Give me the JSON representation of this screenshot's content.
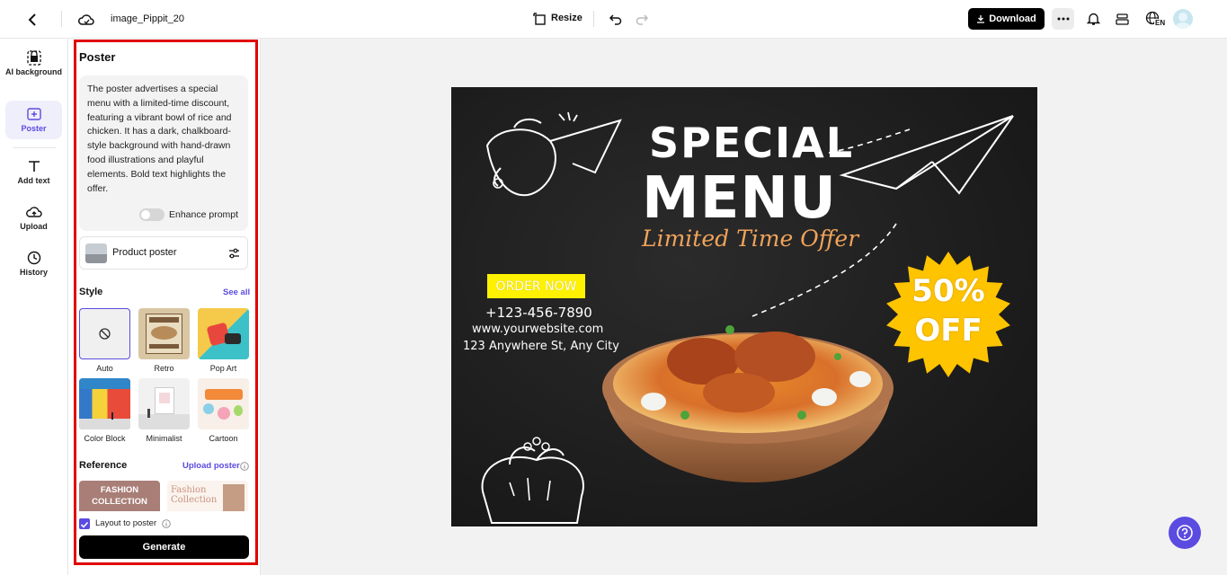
{
  "topbar": {
    "filename": "image_Pippit_20",
    "resize_label": "Resize",
    "download_label": "Download",
    "lang_badge": "EN"
  },
  "leftnav": {
    "items": [
      {
        "label": "AI background",
        "icon": "ai-background-icon"
      },
      {
        "label": "Poster",
        "icon": "poster-icon",
        "active": true
      },
      {
        "label": "Add text",
        "icon": "text-icon"
      },
      {
        "label": "Upload",
        "icon": "upload-icon"
      },
      {
        "label": "History",
        "icon": "history-icon"
      }
    ]
  },
  "panel": {
    "title": "Poster",
    "prompt": "The poster advertises a special menu with a limited-time discount, featuring a vibrant bowl of rice and chicken. It has a dark, chalkboard-style background with hand-drawn food illustrations and playful elements. Bold text highlights the offer.",
    "enhance_label": "Enhance prompt",
    "enhance_on": false,
    "product_label": "Product poster",
    "style_heading": "Style",
    "see_all": "See all",
    "styles": [
      {
        "label": "Auto",
        "selected": true
      },
      {
        "label": "Retro"
      },
      {
        "label": "Pop Art"
      },
      {
        "label": "Color Block"
      },
      {
        "label": "Minimalist"
      },
      {
        "label": "Cartoon"
      }
    ],
    "reference_heading": "Reference",
    "upload_poster": "Upload poster",
    "ref1_text": "FASHION COLLECTION",
    "ref2_text": "Fashion Collection",
    "layout_label": "Layout to poster",
    "layout_checked": true,
    "generate_label": "Generate"
  },
  "poster": {
    "headline1": "SPECIAL",
    "headline2": "MENU",
    "tagline": "Limited Time Offer",
    "order_now": "ORDER NOW",
    "phone": "+123-456-7890",
    "website": "www.yourwebsite.com",
    "address": "123 Anywhere St, Any City",
    "discount1": "50%",
    "discount2": "OFF"
  },
  "colors": {
    "accent": "#5b4be0",
    "highlight_red": "#e00000",
    "order_yellow": "#fff200",
    "badge_yellow": "#ffc400",
    "tagline_orange": "#f0a35a"
  }
}
